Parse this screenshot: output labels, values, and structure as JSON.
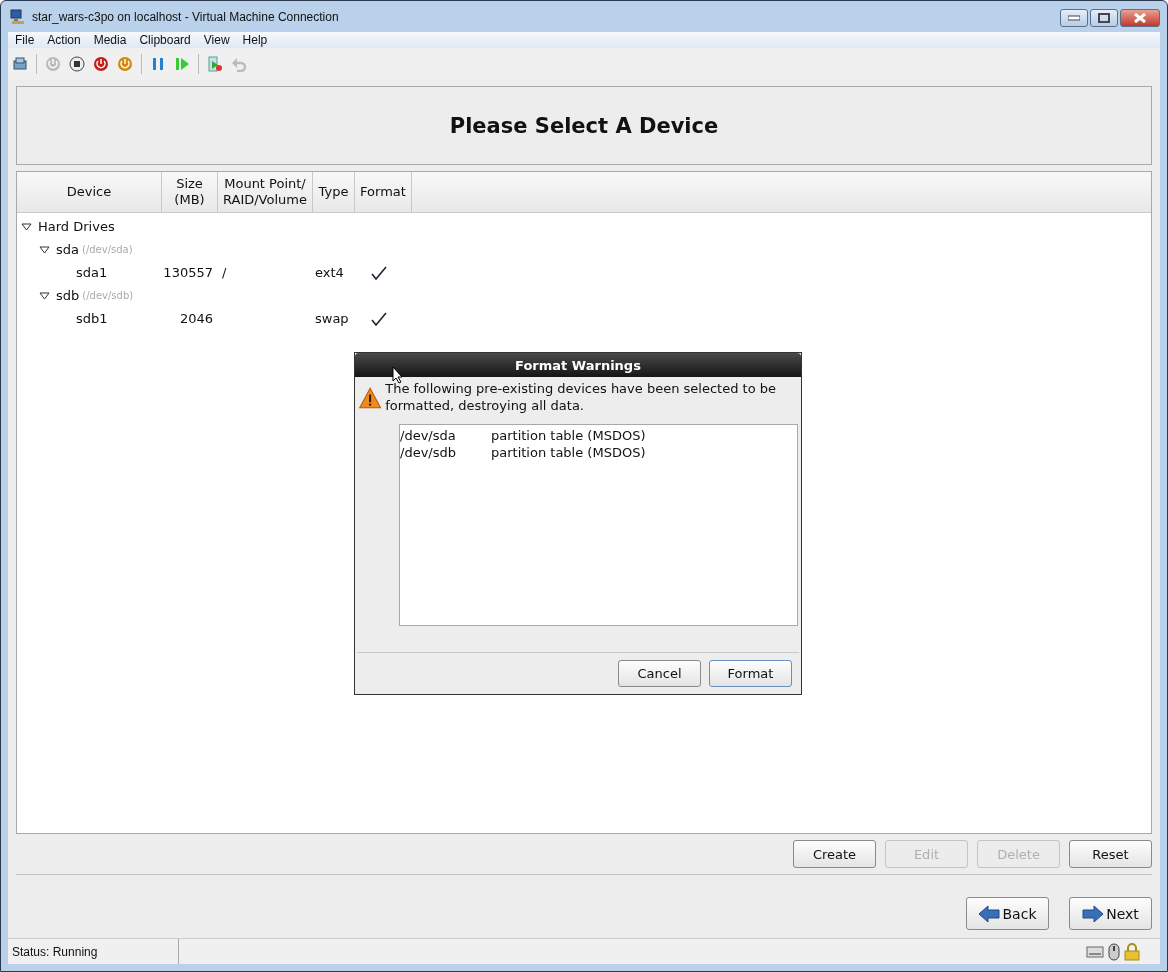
{
  "window": {
    "title": "star_wars-c3po on localhost - Virtual Machine Connection"
  },
  "menu": [
    "File",
    "Action",
    "Media",
    "Clipboard",
    "View",
    "Help"
  ],
  "installer": {
    "heading": "Please Select A Device",
    "columns": [
      "Device",
      "Size\n(MB)",
      "Mount Point/\nRAID/Volume",
      "Type",
      "Format"
    ],
    "tree": [
      {
        "name": "Hard Drives",
        "expanded": true,
        "children": [
          {
            "name": "sda",
            "detail": "(/dev/sda)",
            "expanded": true,
            "children": [
              {
                "name": "sda1",
                "size": "130557",
                "mount": "/",
                "type": "ext4",
                "format": true
              }
            ]
          },
          {
            "name": "sdb",
            "detail": "(/dev/sdb)",
            "expanded": true,
            "children": [
              {
                "name": "sdb1",
                "size": "2046",
                "type": "swap",
                "format": true
              }
            ]
          }
        ]
      }
    ],
    "actions": [
      {
        "label": "Create",
        "disabled": false
      },
      {
        "label": "Edit",
        "disabled": true
      },
      {
        "label": "Delete",
        "disabled": true
      },
      {
        "label": "Reset",
        "disabled": false
      }
    ],
    "nav": [
      {
        "label": "Back",
        "kind": "back",
        "focused": false
      },
      {
        "label": "Next",
        "kind": "next",
        "focused": true
      }
    ]
  },
  "dialog": {
    "title": "Format Warnings",
    "message": "The following pre-existing devices have been selected to be formatted, destroying all data.",
    "items": [
      {
        "device": "/dev/sda",
        "description": "partition table (MSDOS)"
      },
      {
        "device": "/dev/sdb",
        "description": "partition table (MSDOS)"
      }
    ],
    "buttons": [
      {
        "label": "Cancel",
        "focused": false
      },
      {
        "label": "Format",
        "focused": true
      }
    ]
  },
  "status_bar": {
    "text": "Status: Running"
  }
}
